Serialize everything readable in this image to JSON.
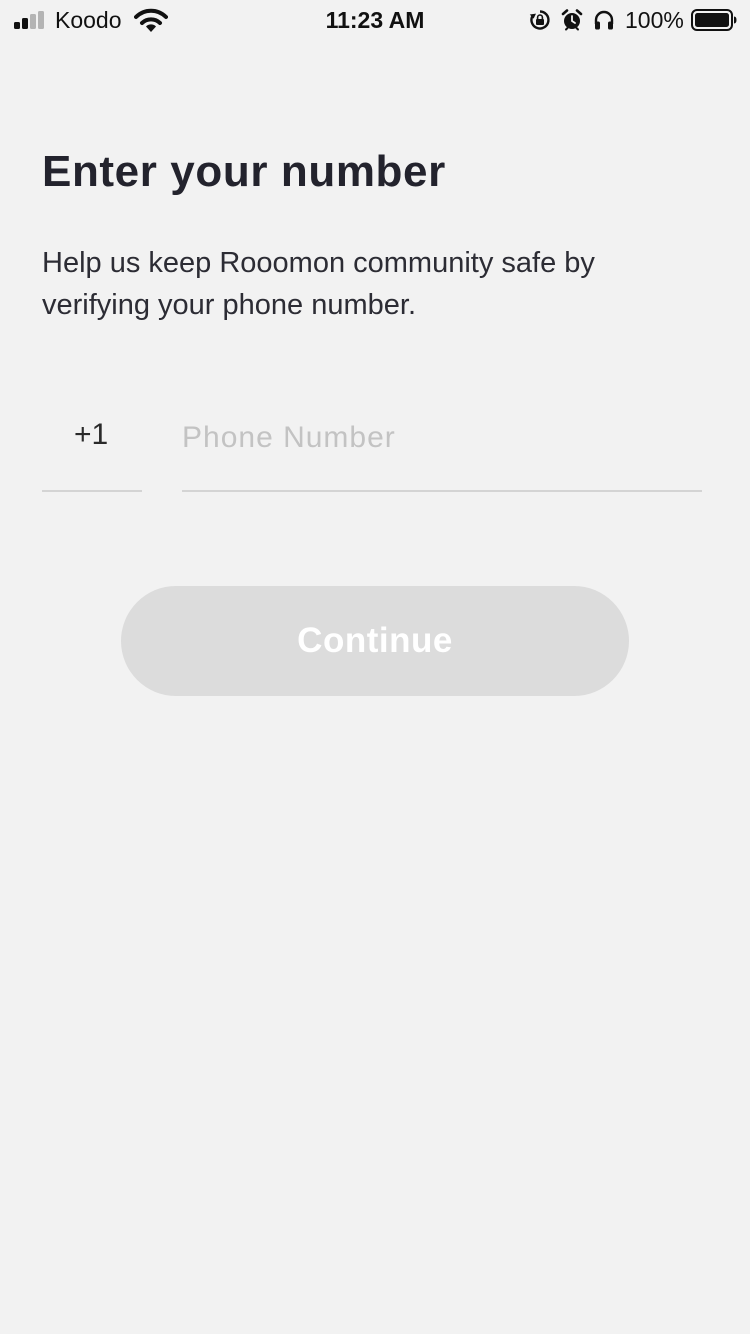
{
  "status_bar": {
    "carrier": "Koodo",
    "time": "11:23 AM",
    "battery_percent": "100%",
    "signal_bars_active": 2,
    "signal_bars_total": 4,
    "icons": [
      "signal-icon",
      "wifi-icon",
      "orientation-lock-icon",
      "alarm-icon",
      "headphones-icon",
      "battery-icon"
    ]
  },
  "page": {
    "title": "Enter your number",
    "subtitle": "Help us keep Rooomon community safe by verifying your phone number."
  },
  "form": {
    "country_code": "+1",
    "phone_value": "",
    "phone_placeholder": "Phone Number",
    "continue_label": "Continue"
  },
  "colors": {
    "background": "#f2f2f2",
    "title": "#23232d",
    "button_disabled": "#dcdcdc",
    "button_text": "#ffffff",
    "placeholder": "#c3c3c3",
    "underline": "#d4d4d4"
  }
}
